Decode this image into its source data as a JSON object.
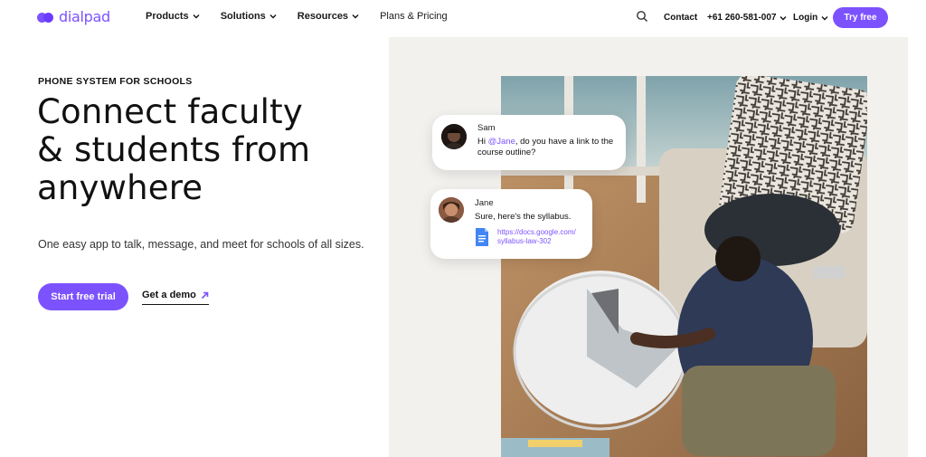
{
  "header": {
    "logo_text": "dialpad",
    "nav": [
      {
        "label": "Products"
      },
      {
        "label": "Solutions"
      },
      {
        "label": "Resources"
      },
      {
        "label": "Plans & Pricing"
      }
    ],
    "search_icon": "search-icon",
    "contact": "Contact",
    "phone": "+61 260-581-007",
    "login": "Login",
    "try_free": "Try free"
  },
  "hero": {
    "eyebrow": "PHONE SYSTEM FOR SCHOOLS",
    "headline_lines": [
      "Connect faculty",
      "& students from",
      "anywhere"
    ],
    "subhead": "One easy app to talk, message, and meet for schools of all sizes.",
    "cta_primary": "Start free trial",
    "cta_secondary": "Get a demo",
    "cta_secondary_icon": "arrow-up-right-icon"
  },
  "chat": {
    "sam": {
      "name": "Sam",
      "text_prefix": "Hi ",
      "mention": "@Jane",
      "text_suffix": ", do you have a link to the course outline?"
    },
    "jane": {
      "name": "Jane",
      "text": "Sure, here's the syllabus.",
      "doc_icon": "google-doc-icon",
      "link_line1": "https://docs.google.com/",
      "link_line2": "syllabus-law-302"
    }
  },
  "colors": {
    "brand": "#7c52ff",
    "hero_bg": "#f3f1ee"
  }
}
